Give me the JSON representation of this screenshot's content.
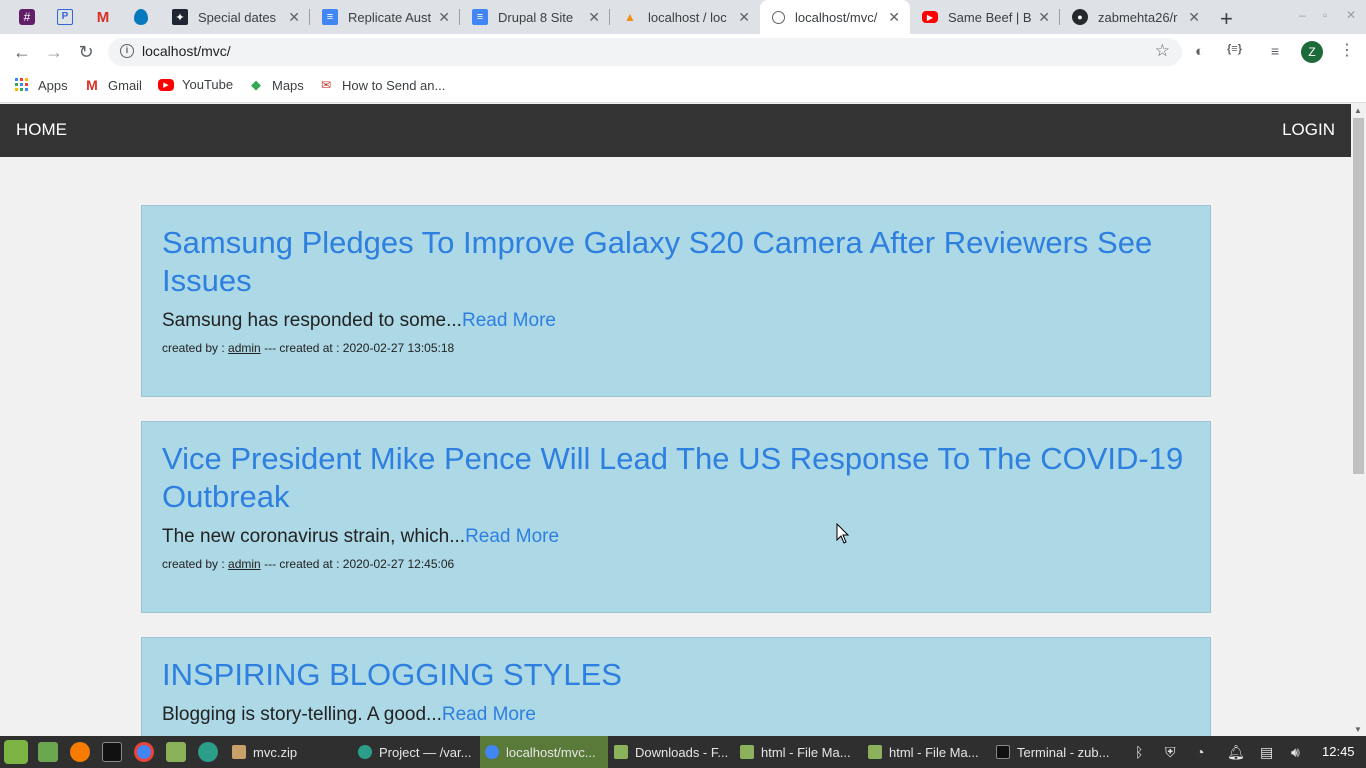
{
  "browser": {
    "tabs": [
      {
        "title": "Special dates",
        "icon": "star-icon"
      },
      {
        "title": "Replicate Aust",
        "icon": "docs-icon"
      },
      {
        "title": "Drupal 8 Site",
        "icon": "docs-icon"
      },
      {
        "title": "localhost / loc",
        "icon": "phpmyadmin-icon"
      },
      {
        "title": "localhost/mvc/",
        "icon": "globe-icon",
        "active": true
      },
      {
        "title": "Same Beef | B",
        "icon": "youtube-icon"
      },
      {
        "title": "zabmehta26/r",
        "icon": "github-icon"
      }
    ],
    "address": "localhost/mvc/",
    "profile_initial": "Z",
    "bookmarks": [
      {
        "label": "Apps",
        "icon": "apps-icon"
      },
      {
        "label": "Gmail",
        "icon": "gmail-icon"
      },
      {
        "label": "YouTube",
        "icon": "youtube-icon"
      },
      {
        "label": "Maps",
        "icon": "maps-icon"
      },
      {
        "label": "How to Send an...",
        "icon": "bookmark-icon"
      }
    ]
  },
  "navbar": {
    "home": "HOME",
    "login": "LOGIN"
  },
  "posts": [
    {
      "title": "Samsung Pledges To Improve Galaxy S20 Camera After Reviewers See Issues",
      "excerpt": "Samsung has responded to some...",
      "read_more": "Read More",
      "created_by_label": "created by :",
      "author": "admin",
      "created_at_label": "--- created at :",
      "created_at": "2020-02-27 13:05:18"
    },
    {
      "title": "Vice President Mike Pence Will Lead The US Response To The COVID-19 Outbreak",
      "excerpt": "The new coronavirus strain, which...",
      "read_more": "Read More",
      "created_by_label": "created by :",
      "author": "admin",
      "created_at_label": "--- created at :",
      "created_at": "2020-02-27 12:45:06"
    },
    {
      "title": "INSPIRING BLOGGING STYLES",
      "excerpt": "Blogging is story-telling. A good...",
      "read_more": "Read More"
    }
  ],
  "taskbar": {
    "items": [
      {
        "label": "mvc.zip"
      },
      {
        "label": "Project — /var..."
      },
      {
        "label": "localhost/mvc...",
        "active": true
      },
      {
        "label": "Downloads - F..."
      },
      {
        "label": "html - File Ma..."
      },
      {
        "label": "html - File Ma..."
      },
      {
        "label": "Terminal - zub..."
      }
    ],
    "clock": "12:45"
  },
  "colors": {
    "navbar_bg": "#333333",
    "card_bg": "#add8e6",
    "link": "#2d7fe0",
    "taskbar_bg": "#2f2f2f"
  }
}
